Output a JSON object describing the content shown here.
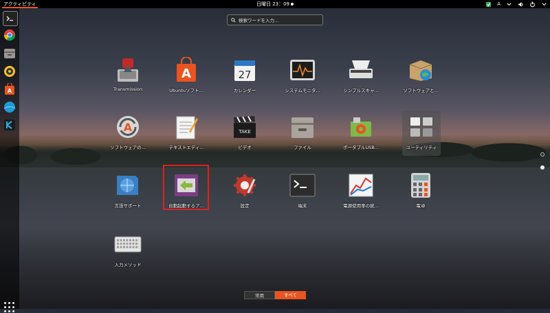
{
  "topbar": {
    "activities": "アクティビティ",
    "clock": "日曜日 23：09",
    "keyboard_indicator": "A"
  },
  "search": {
    "placeholder": "検索ワードを入力..."
  },
  "dock": {
    "items": [
      "terminal",
      "chrome",
      "files",
      "rhythmbox",
      "software-center",
      "globe",
      "kodi"
    ]
  },
  "apps": [
    {
      "label": "Transmission",
      "icon": "transmission-icon"
    },
    {
      "label": "Ubuntuソフト...",
      "icon": "ubuntu-software-icon"
    },
    {
      "label": "カレンダー",
      "icon": "calendar-icon",
      "day": "27"
    },
    {
      "label": "システムモニタ...",
      "icon": "system-monitor-icon"
    },
    {
      "label": "シンプルスキャ...",
      "icon": "scanner-icon"
    },
    {
      "label": "ソフトウェアと...",
      "icon": "software-updates-icon"
    },
    {
      "label": "ソフトウェアの...",
      "icon": "software-updater-icon"
    },
    {
      "label": "テキストエディ...",
      "icon": "text-editor-icon"
    },
    {
      "label": "ビデオ",
      "icon": "videos-icon"
    },
    {
      "label": "ファイル",
      "icon": "files-icon"
    },
    {
      "label": "ポータブルUSB...",
      "icon": "usb-creator-icon"
    },
    {
      "label": "ユーティリティ",
      "icon": "utilities-folder-icon"
    },
    {
      "label": "言語サポート",
      "icon": "language-support-icon"
    },
    {
      "label": "自動起動するア...",
      "icon": "startup-apps-icon"
    },
    {
      "label": "設定",
      "icon": "settings-icon"
    },
    {
      "label": "端末",
      "icon": "terminal-icon"
    },
    {
      "label": "電源使用率の統...",
      "icon": "power-statistics-icon"
    },
    {
      "label": "電卓",
      "icon": "calculator-icon"
    },
    {
      "label": "入力メソッド",
      "icon": "input-method-icon"
    }
  ],
  "view_switch": {
    "frequent": "常用",
    "all": "すべて"
  },
  "colors": {
    "accent": "#e95420",
    "highlight": "#e02020"
  }
}
